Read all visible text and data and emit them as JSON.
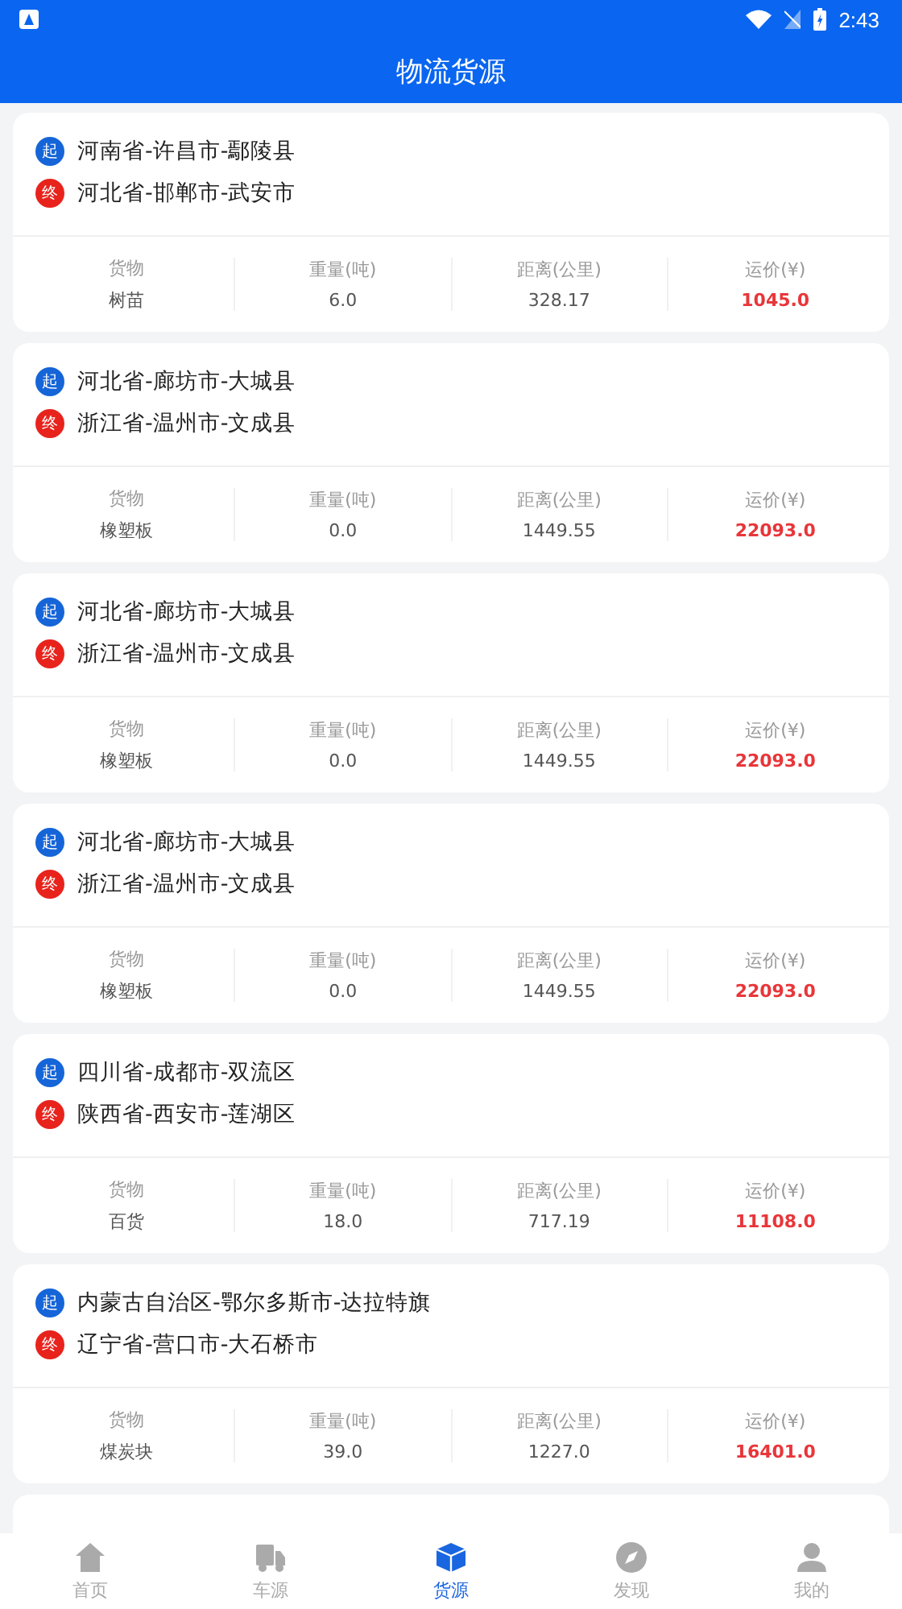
{
  "status_bar": {
    "time": "2:43"
  },
  "header": {
    "title": "物流货源"
  },
  "cargo_list": [
    {
      "start_badge": "起",
      "start": "河南省-许昌市-鄢陵县",
      "end_badge": "终",
      "end": "河北省-邯郸市-武安市",
      "stats": [
        {
          "label": "货物",
          "value": "树苗"
        },
        {
          "label": "重量(吨)",
          "value": "6.0"
        },
        {
          "label": "距离(公里)",
          "value": "328.17"
        },
        {
          "label": "运价(¥)",
          "value": "1045.0",
          "kind": "price"
        }
      ]
    },
    {
      "start_badge": "起",
      "start": "河北省-廊坊市-大城县",
      "end_badge": "终",
      "end": "浙江省-温州市-文成县",
      "stats": [
        {
          "label": "货物",
          "value": "橡塑板"
        },
        {
          "label": "重量(吨)",
          "value": "0.0"
        },
        {
          "label": "距离(公里)",
          "value": "1449.55"
        },
        {
          "label": "运价(¥)",
          "value": "22093.0",
          "kind": "price"
        }
      ]
    },
    {
      "start_badge": "起",
      "start": "河北省-廊坊市-大城县",
      "end_badge": "终",
      "end": "浙江省-温州市-文成县",
      "stats": [
        {
          "label": "货物",
          "value": "橡塑板"
        },
        {
          "label": "重量(吨)",
          "value": "0.0"
        },
        {
          "label": "距离(公里)",
          "value": "1449.55"
        },
        {
          "label": "运价(¥)",
          "value": "22093.0",
          "kind": "price"
        }
      ]
    },
    {
      "start_badge": "起",
      "start": "河北省-廊坊市-大城县",
      "end_badge": "终",
      "end": "浙江省-温州市-文成县",
      "stats": [
        {
          "label": "货物",
          "value": "橡塑板"
        },
        {
          "label": "重量(吨)",
          "value": "0.0"
        },
        {
          "label": "距离(公里)",
          "value": "1449.55"
        },
        {
          "label": "运价(¥)",
          "value": "22093.0",
          "kind": "price"
        }
      ]
    },
    {
      "start_badge": "起",
      "start": "四川省-成都市-双流区",
      "end_badge": "终",
      "end": "陕西省-西安市-莲湖区",
      "stats": [
        {
          "label": "货物",
          "value": "百货"
        },
        {
          "label": "重量(吨)",
          "value": "18.0"
        },
        {
          "label": "距离(公里)",
          "value": "717.19"
        },
        {
          "label": "运价(¥)",
          "value": "11108.0",
          "kind": "price"
        }
      ]
    },
    {
      "start_badge": "起",
      "start": "内蒙古自治区-鄂尔多斯市-达拉特旗",
      "end_badge": "终",
      "end": "辽宁省-营口市-大石桥市",
      "stats": [
        {
          "label": "货物",
          "value": "煤炭块"
        },
        {
          "label": "重量(吨)",
          "value": "39.0"
        },
        {
          "label": "距离(公里)",
          "value": "1227.0"
        },
        {
          "label": "运价(¥)",
          "value": "16401.0",
          "kind": "price"
        }
      ]
    }
  ],
  "tab_bar": [
    {
      "kind": "home",
      "label": "首页",
      "selected": false
    },
    {
      "kind": "truck",
      "label": "车源",
      "selected": false
    },
    {
      "kind": "box",
      "label": "货源",
      "selected": true
    },
    {
      "kind": "compass",
      "label": "发现",
      "selected": false
    },
    {
      "kind": "person",
      "label": "我的",
      "selected": false
    }
  ]
}
